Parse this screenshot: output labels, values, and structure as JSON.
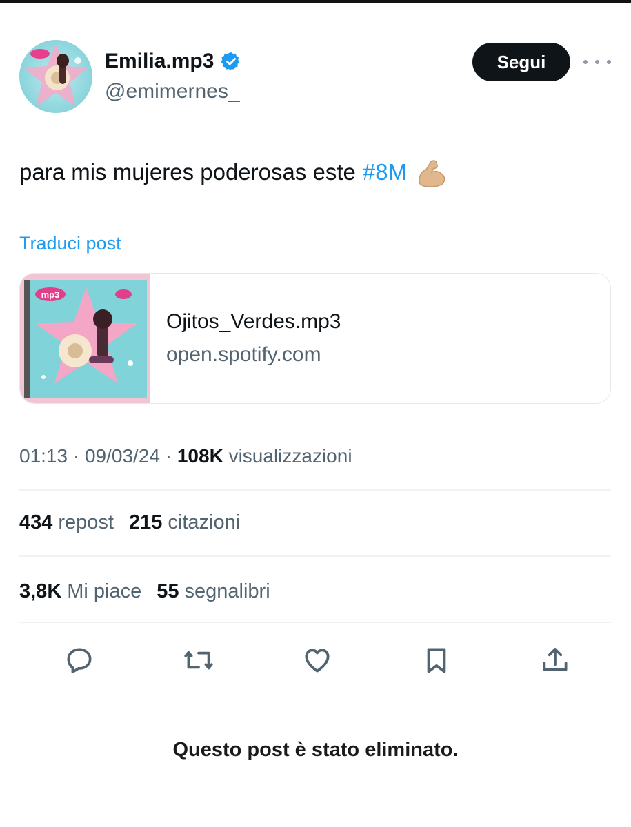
{
  "header": {
    "display_name": "Emilia.mp3",
    "handle": "@emimernes_",
    "follow_label": "Segui",
    "verified_icon": "verified-badge-icon",
    "more_icon": "more-icon"
  },
  "post": {
    "text": "para mis mujeres poderosas este",
    "hashtag": "#8M",
    "emoji_icon": "flexed-biceps-icon",
    "translate_label": "Traduci post"
  },
  "card": {
    "title": "Ojitos_Verdes.mp3",
    "domain": "open.spotify.com",
    "thumbnail": "album-cover-image"
  },
  "meta": {
    "time": "01:13",
    "date": "09/03/24",
    "views_count": "108K",
    "views_label": "visualizzazioni",
    "separator": "·"
  },
  "stats": {
    "reposts_count": "434",
    "reposts_label": "repost",
    "quotes_count": "215",
    "quotes_label": "citazioni",
    "likes_count": "3,8K",
    "likes_label": "Mi piace",
    "bookmarks_count": "55",
    "bookmarks_label": "segnalibri"
  },
  "actions": [
    "reply-icon",
    "repost-icon",
    "like-icon",
    "bookmark-icon",
    "share-icon"
  ],
  "footer": {
    "deleted_notice": "Questo post è stato eliminato."
  },
  "colors": {
    "accent": "#1d9bf0",
    "text": "#0f1419",
    "muted": "#536471",
    "follow_bg": "#0f1419"
  }
}
